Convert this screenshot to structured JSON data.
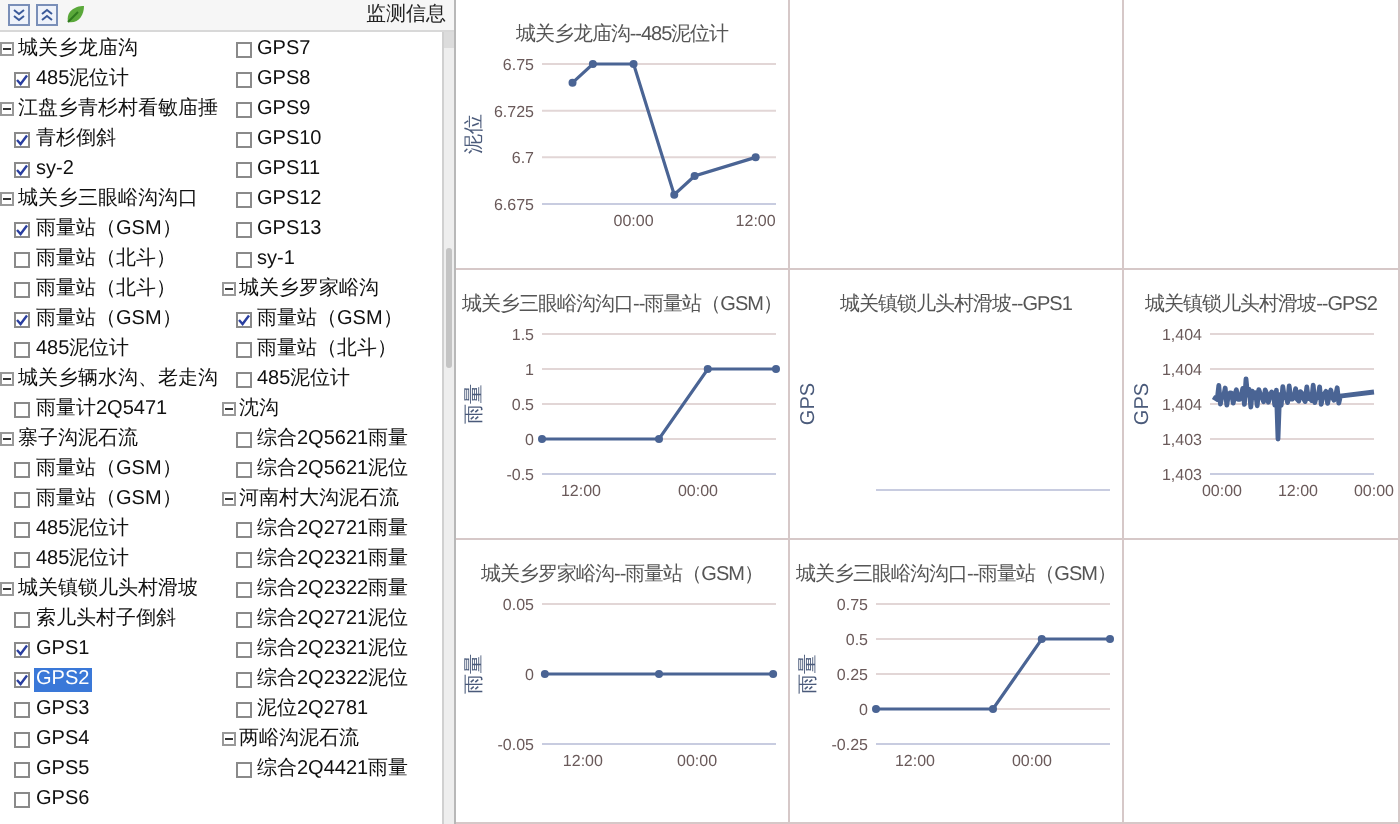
{
  "sidebar": {
    "title": "监测信息",
    "tree": [
      {
        "label": "城关乡龙庙沟",
        "expanded": true,
        "children": [
          {
            "label": "485泥位计",
            "checked": true,
            "selected": false
          }
        ]
      },
      {
        "label": "江盘乡青杉村看敏庙捶",
        "expanded": true,
        "children": [
          {
            "label": "青杉倒斜",
            "checked": true,
            "selected": false
          },
          {
            "label": "sy-2",
            "checked": true,
            "selected": false
          }
        ]
      },
      {
        "label": "城关乡三眼峪沟沟口",
        "expanded": true,
        "children": [
          {
            "label": "雨量站（GSM）",
            "checked": true,
            "selected": false
          },
          {
            "label": "雨量站（北斗）",
            "checked": false,
            "selected": false
          },
          {
            "label": "雨量站（北斗）",
            "checked": false,
            "selected": false
          },
          {
            "label": "雨量站（GSM）",
            "checked": true,
            "selected": false
          },
          {
            "label": "485泥位计",
            "checked": false,
            "selected": false
          }
        ]
      },
      {
        "label": "城关乡辆水沟、老走沟",
        "expanded": true,
        "children": [
          {
            "label": "雨量计2Q5471",
            "checked": false,
            "selected": false
          }
        ]
      },
      {
        "label": "寨子沟泥石流",
        "expanded": true,
        "children": [
          {
            "label": "雨量站（GSM）",
            "checked": false,
            "selected": false
          },
          {
            "label": "雨量站（GSM）",
            "checked": false,
            "selected": false
          },
          {
            "label": "485泥位计",
            "checked": false,
            "selected": false
          },
          {
            "label": "485泥位计",
            "checked": false,
            "selected": false
          }
        ]
      },
      {
        "label": "城关镇锁儿头村滑坡",
        "expanded": true,
        "children": [
          {
            "label": "索儿头村子倒斜",
            "checked": false,
            "selected": false
          },
          {
            "label": "GPS1",
            "checked": true,
            "selected": false
          },
          {
            "label": "GPS2",
            "checked": true,
            "selected": true
          },
          {
            "label": "GPS3",
            "checked": false,
            "selected": false
          },
          {
            "label": "GPS4",
            "checked": false,
            "selected": false
          },
          {
            "label": "GPS5",
            "checked": false,
            "selected": false
          },
          {
            "label": "GPS6",
            "checked": false,
            "selected": false
          },
          {
            "label": "GPS7",
            "checked": false,
            "selected": false
          },
          {
            "label": "GPS8",
            "checked": false,
            "selected": false
          },
          {
            "label": "GPS9",
            "checked": false,
            "selected": false
          },
          {
            "label": "GPS10",
            "checked": false,
            "selected": false
          },
          {
            "label": "GPS11",
            "checked": false,
            "selected": false
          },
          {
            "label": "GPS12",
            "checked": false,
            "selected": false
          },
          {
            "label": "GPS13",
            "checked": false,
            "selected": false
          },
          {
            "label": "sy-1",
            "checked": false,
            "selected": false
          }
        ]
      },
      {
        "label": "城关乡罗家峪沟",
        "expanded": true,
        "children": [
          {
            "label": "雨量站（GSM）",
            "checked": true,
            "selected": false
          },
          {
            "label": "雨量站（北斗）",
            "checked": false,
            "selected": false
          },
          {
            "label": "485泥位计",
            "checked": false,
            "selected": false
          }
        ]
      },
      {
        "label": "沈沟",
        "expanded": true,
        "children": [
          {
            "label": "综合2Q5621雨量",
            "checked": false,
            "selected": false
          },
          {
            "label": "综合2Q5621泥位",
            "checked": false,
            "selected": false
          }
        ]
      },
      {
        "label": "河南村大沟泥石流",
        "expanded": true,
        "children": [
          {
            "label": "综合2Q2721雨量",
            "checked": false,
            "selected": false
          },
          {
            "label": "综合2Q2321雨量",
            "checked": false,
            "selected": false
          },
          {
            "label": "综合2Q2322雨量",
            "checked": false,
            "selected": false
          },
          {
            "label": "综合2Q2721泥位",
            "checked": false,
            "selected": false
          },
          {
            "label": "综合2Q2321泥位",
            "checked": false,
            "selected": false
          },
          {
            "label": "综合2Q2322泥位",
            "checked": false,
            "selected": false
          },
          {
            "label": "泥位2Q2781",
            "checked": false,
            "selected": false
          }
        ]
      },
      {
        "label": "两峪沟泥石流",
        "expanded": true,
        "children": [
          {
            "label": "综合2Q4421雨量",
            "checked": false,
            "selected": false
          }
        ]
      }
    ]
  },
  "panels": [
    {
      "kind": "chart",
      "chart_data": {
        "type": "line",
        "title": "城关乡龙庙沟--485泥位计",
        "ylabel": "泥位",
        "grid": true,
        "x": [
          -6,
          -4,
          0,
          4,
          6,
          12
        ],
        "series": [
          {
            "color": "#4a6494",
            "marker": "circle",
            "values": [
              6.74,
              6.75,
              6.75,
              6.68,
              6.69,
              6.7
            ]
          }
        ],
        "xlim": [
          -9,
          14
        ],
        "ylim": [
          6.675,
          6.75
        ],
        "xticks": [
          {
            "value": 0,
            "label": "00:00"
          },
          {
            "value": 12,
            "label": "12:00"
          }
        ],
        "yticks": [
          6.675,
          6.7,
          6.725,
          6.75
        ]
      }
    },
    {
      "kind": "empty"
    },
    {
      "kind": "empty"
    },
    {
      "kind": "chart",
      "chart_data": {
        "type": "line",
        "title": "城关乡三眼峪沟沟口--雨量站（GSM）",
        "ylabel": "雨量",
        "grid": true,
        "x": [
          8,
          20,
          25,
          32
        ],
        "series": [
          {
            "color": "#4a6494",
            "marker": "circle",
            "values": [
              0,
              0,
              1,
              1
            ]
          }
        ],
        "xlim": [
          8,
          32
        ],
        "ylim": [
          -0.5,
          1.5
        ],
        "xticks": [
          {
            "value": 12,
            "label": "12:00"
          },
          {
            "value": 24,
            "label": "00:00"
          }
        ],
        "yticks": [
          -0.5,
          0,
          0.5,
          1,
          1.5
        ]
      }
    },
    {
      "kind": "blank",
      "title": "城关镇锁儿头村滑坡--GPS1",
      "ylabel": "GPS"
    },
    {
      "kind": "trace",
      "title": "城关镇锁儿头村滑坡--GPS2",
      "ylabel": "GPS",
      "ytick_labels": [
        "1,404",
        "1,404",
        "1,404",
        "1,403",
        "1,403"
      ],
      "xtick_labels": [
        "00:00",
        "12:00",
        "00:00"
      ]
    },
    {
      "kind": "chart",
      "chart_data": {
        "type": "line",
        "title": "城关乡罗家峪沟--雨量站（GSM）",
        "ylabel": "雨量",
        "grid": true,
        "x": [
          8,
          20,
          32
        ],
        "series": [
          {
            "color": "#4a6494",
            "marker": "circle",
            "values": [
              0,
              0,
              0
            ]
          }
        ],
        "xlim": [
          7.7,
          32.3
        ],
        "ylim": [
          -0.05,
          0.05
        ],
        "xticks": [
          {
            "value": 12,
            "label": "12:00"
          },
          {
            "value": 24,
            "label": "00:00"
          }
        ],
        "yticks": [
          -0.05,
          0,
          0.05
        ]
      }
    },
    {
      "kind": "chart",
      "chart_data": {
        "type": "line",
        "title": "城关乡三眼峪沟沟口--雨量站（GSM）",
        "ylabel": "雨量",
        "grid": true,
        "x": [
          8,
          20,
          25,
          32
        ],
        "series": [
          {
            "color": "#4a6494",
            "marker": "circle",
            "values": [
              0,
              0,
              0.5,
              0.5
            ]
          }
        ],
        "xlim": [
          8,
          32
        ],
        "ylim": [
          -0.25,
          0.75
        ],
        "xticks": [
          {
            "value": 12,
            "label": "12:00"
          },
          {
            "value": 24,
            "label": "00:00"
          }
        ],
        "yticks": [
          -0.25,
          0,
          0.25,
          0.5,
          0.75
        ]
      }
    },
    {
      "kind": "empty"
    }
  ]
}
